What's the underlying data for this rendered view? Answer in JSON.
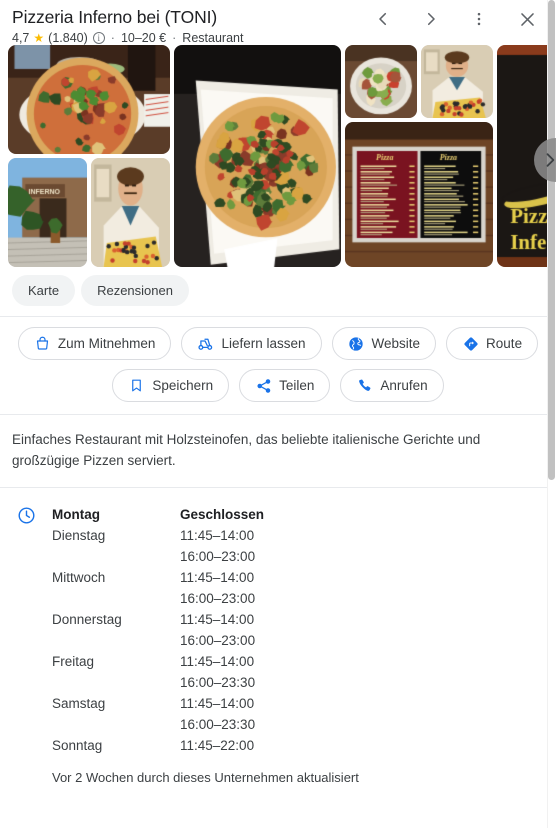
{
  "place": {
    "title": "Pizzeria Inferno bei (TONI)",
    "rating": "4,7",
    "star_icon": "star-icon",
    "review_count": "(1.840)",
    "info_icon": "info-icon",
    "separator": "·",
    "price_range": "10–20 €",
    "category": "Restaurant"
  },
  "header_actions": [
    {
      "name": "back-button",
      "icon": "chevron-left-icon"
    },
    {
      "name": "forward-button",
      "icon": "chevron-right-icon"
    },
    {
      "name": "more-options-button",
      "icon": "more-vertical-icon"
    },
    {
      "name": "close-button",
      "icon": "close-icon"
    }
  ],
  "gallery": {
    "next_icon": "chevron-right-icon",
    "photos": [
      {
        "name": "photo-pizza-table",
        "alt": "Pizza auf Teller auf Holztisch"
      },
      {
        "name": "photo-restaurant-exterior",
        "alt": "Außenansicht Restaurant Inferno"
      },
      {
        "name": "photo-pizzaiolo-mural",
        "alt": "Wandbild Pizzabäcker"
      },
      {
        "name": "photo-pizza-box",
        "alt": "Große Pizza in Karton"
      },
      {
        "name": "photo-salad-plate",
        "alt": "Salat mit Hähnchen"
      },
      {
        "name": "photo-pizzaiolo-mural-2",
        "alt": "Wandbild Pizzabäcker"
      },
      {
        "name": "photo-menu-board",
        "alt": "Speisekarte Pizzen"
      },
      {
        "name": "photo-sign-inferno",
        "alt": "Schild Pizzeria Inferno"
      }
    ]
  },
  "tabs": [
    {
      "name": "tab-karte",
      "label": "Karte"
    },
    {
      "name": "tab-rezensionen",
      "label": "Rezensionen"
    }
  ],
  "actions": {
    "row1": [
      {
        "name": "takeaway-button",
        "label": "Zum Mitnehmen",
        "icon": "takeout-bag-icon"
      },
      {
        "name": "delivery-button",
        "label": "Liefern lassen",
        "icon": "scooter-icon"
      },
      {
        "name": "website-button",
        "label": "Website",
        "icon": "globe-icon"
      },
      {
        "name": "directions-button",
        "label": "Route",
        "icon": "directions-icon"
      }
    ],
    "row2": [
      {
        "name": "save-button",
        "label": "Speichern",
        "icon": "bookmark-icon"
      },
      {
        "name": "share-button",
        "label": "Teilen",
        "icon": "share-icon"
      },
      {
        "name": "call-button",
        "label": "Anrufen",
        "icon": "phone-icon"
      }
    ]
  },
  "description": "Einfaches Restaurant mit Holzsteinofen, das beliebte italienische Gerichte und großzügige Pizzen serviert.",
  "hours": {
    "clock_icon": "clock-icon",
    "rows": [
      {
        "day": "Montag",
        "times": [
          "Geschlossen"
        ],
        "today": true
      },
      {
        "day": "Dienstag",
        "times": [
          "11:45–14:00",
          "16:00–23:00"
        ],
        "today": false
      },
      {
        "day": "Mittwoch",
        "times": [
          "11:45–14:00",
          "16:00–23:00"
        ],
        "today": false
      },
      {
        "day": "Donnerstag",
        "times": [
          "11:45–14:00",
          "16:00–23:00"
        ],
        "today": false
      },
      {
        "day": "Freitag",
        "times": [
          "11:45–14:00",
          "16:00–23:30"
        ],
        "today": false
      },
      {
        "day": "Samstag",
        "times": [
          "11:45–14:00",
          "16:00–23:30"
        ],
        "today": false
      },
      {
        "day": "Sonntag",
        "times": [
          "11:45–22:00"
        ],
        "today": false
      }
    ],
    "updated": "Vor 2 Wochen durch dieses Unternehmen aktualisiert"
  },
  "colors": {
    "accent": "#1a73e8",
    "star": "#fbbc04",
    "text_primary": "#202124",
    "text_secondary": "#3c4043",
    "chip_bg": "#f1f3f4",
    "divider": "#e8eaed"
  }
}
